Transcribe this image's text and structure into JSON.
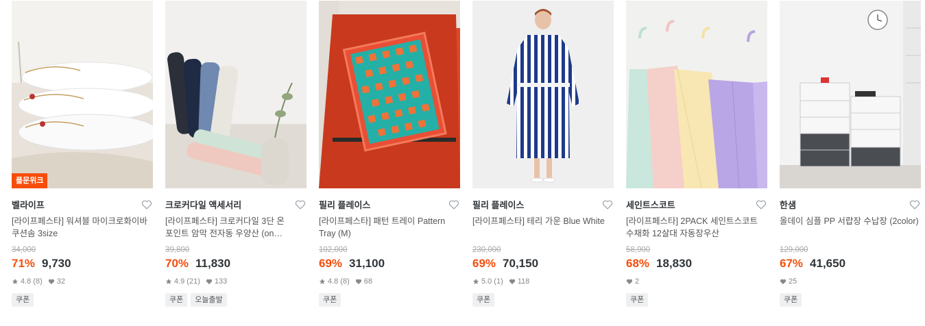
{
  "products": [
    {
      "badge": "플문위크",
      "brand": "벨라이프",
      "title": "[라이프페스타] 워셔블 마이크로화이바 쿠션솜 3size",
      "original_price": "34,000",
      "discount": "71%",
      "price": "9,730",
      "rating": "4.8",
      "reviews": "(8)",
      "likes": "32",
      "tags": [
        "쿠폰"
      ],
      "image": "stack-of-white-pillows"
    },
    {
      "badge": "",
      "brand": "크로커다일 액세서리",
      "title": "[라이프페스타] 크로커다일 3단 온 포인트 암막 전자동 우양산 (on…",
      "original_price": "39,800",
      "discount": "70%",
      "price": "11,830",
      "rating": "4.9",
      "reviews": "(21)",
      "likes": "133",
      "tags": [
        "쿠폰",
        "오늘출발"
      ],
      "image": "folded-umbrellas"
    },
    {
      "badge": "",
      "brand": "필리 플레이스",
      "title": "[라이프페스타] 패턴 트레이 Pattern Tray (M)",
      "original_price": "102,000",
      "discount": "69%",
      "price": "31,100",
      "rating": "4.8",
      "reviews": "(8)",
      "likes": "68",
      "tags": [
        "쿠폰"
      ],
      "image": "pattern-tray-on-red-chair"
    },
    {
      "badge": "",
      "brand": "필리 플레이스",
      "title": "[라이프페스타] 테리 가운 Blue White",
      "original_price": "230,000",
      "discount": "69%",
      "price": "70,150",
      "rating": "5.0",
      "reviews": "(1)",
      "likes": "118",
      "tags": [
        "쿠폰"
      ],
      "image": "striped-robe"
    },
    {
      "badge": "",
      "brand": "세인트스코트",
      "title": "[라이프페스타] 2PACK 세인트스코트 수채화 12살대 자동장우산",
      "original_price": "58,900",
      "discount": "68%",
      "price": "18,830",
      "rating": "",
      "reviews": "",
      "likes": "2",
      "tags": [
        "쿠폰"
      ],
      "image": "pastel-umbrellas"
    },
    {
      "badge": "",
      "brand": "한샘",
      "title": "올데이 심플 PP 서랍장 수납장 (2color)",
      "original_price": "129,000",
      "discount": "67%",
      "price": "41,650",
      "rating": "",
      "reviews": "",
      "likes": "25",
      "tags": [
        "쿠폰"
      ],
      "image": "drawer-cabinet"
    }
  ],
  "colors": {
    "accent": "#f74d0a",
    "text": "#2f3438",
    "muted": "#888888"
  }
}
